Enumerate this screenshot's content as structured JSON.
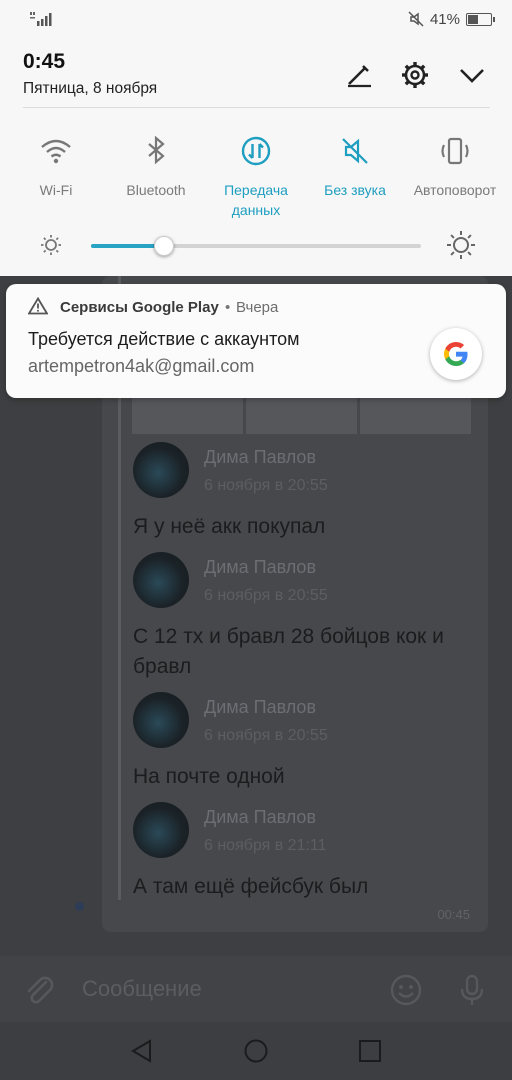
{
  "status_bar": {
    "battery_text": "41%",
    "battery_level": 0.41
  },
  "panel": {
    "time": "0:45",
    "date": "Пятница, 8 ноября",
    "tiles": [
      {
        "label": "Wi-Fi",
        "icon": "wifi-icon",
        "active": false
      },
      {
        "label": "Bluetooth",
        "icon": "bluetooth-icon",
        "active": false
      },
      {
        "label": "Передача данных",
        "icon": "mobile-data-icon",
        "active": true
      },
      {
        "label": "Без звука",
        "icon": "mute-icon",
        "active": true
      },
      {
        "label": "Автоповорот",
        "icon": "auto-rotate-icon",
        "active": false
      }
    ],
    "brightness_level": 0.22,
    "accent_color": "#1e9ec0"
  },
  "notification": {
    "app_name": "Сервисы Google Play",
    "separator": "•",
    "time": "Вчера",
    "title": "Требуется действие с аккаунтом",
    "body": "artempetron4ak@gmail.com"
  },
  "chat": {
    "messages": [
      {
        "author": "Дима Павлов",
        "date": "6 ноября в 20:55",
        "text": "Я у неё акк покупал"
      },
      {
        "author": "Дима Павлов",
        "date": "6 ноября в 20:55",
        "text": "С 12 тх и бравл 28 бойцов кок и бравл"
      },
      {
        "author": "Дима Павлов",
        "date": "6 ноября в 20:55",
        "text": "На почте одной"
      },
      {
        "author": "Дима Павлов",
        "date": "6 ноября в 21:11",
        "text": "А там ещё фейсбук был"
      }
    ],
    "time": "00:45"
  },
  "composer": {
    "placeholder": "Сообщение"
  }
}
